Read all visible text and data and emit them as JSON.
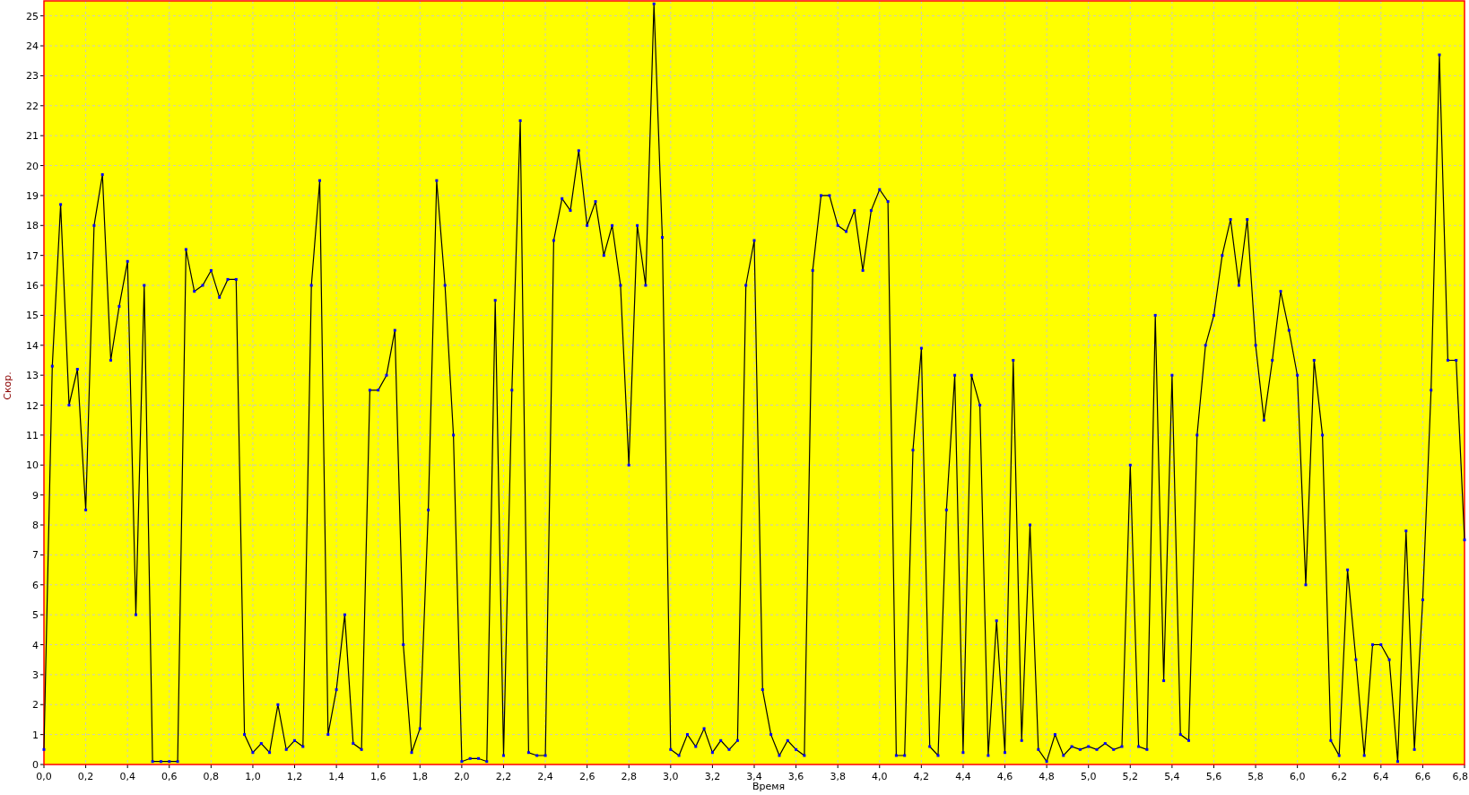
{
  "chart": {
    "chart_data": {
      "type": "line",
      "xlabel": "Время",
      "ylabel": "Скор.",
      "x": [
        0,
        0.04,
        0.08,
        0.12,
        0.16,
        0.2,
        0.24,
        0.28,
        0.32,
        0.36,
        0.4,
        0.44,
        0.48,
        0.52,
        0.56,
        0.6,
        0.64,
        0.68,
        0.72,
        0.76,
        0.8,
        0.84,
        0.88,
        0.92,
        0.96,
        1,
        1.04,
        1.08,
        1.12,
        1.16,
        1.2,
        1.24,
        1.28,
        1.32,
        1.36,
        1.4,
        1.44,
        1.48,
        1.52,
        1.56,
        1.6,
        1.64,
        1.68,
        1.72,
        1.76,
        1.8,
        1.84,
        1.88,
        1.92,
        1.96,
        2,
        2.04,
        2.08,
        2.12,
        2.16,
        2.2,
        2.24,
        2.28,
        2.32,
        2.36,
        2.4,
        2.44,
        2.48,
        2.52,
        2.56,
        2.6,
        2.64,
        2.68,
        2.72,
        2.76,
        2.8,
        2.84,
        2.88,
        2.92,
        2.96,
        3,
        3.04,
        3.08,
        3.12,
        3.16,
        3.2,
        3.24,
        3.28,
        3.32,
        3.36,
        3.4,
        3.44,
        3.48,
        3.52,
        3.56,
        3.6,
        3.64,
        3.68,
        3.72,
        3.76,
        3.8,
        3.84,
        3.88,
        3.92,
        3.96,
        4,
        4.04,
        4.08,
        4.12,
        4.16,
        4.2,
        4.24,
        4.28,
        4.32,
        4.36,
        4.4,
        4.44,
        4.48,
        4.52,
        4.56,
        4.6,
        4.64,
        4.68,
        4.72,
        4.76,
        4.8,
        4.84,
        4.88,
        4.92,
        4.96,
        5,
        5.04,
        5.08,
        5.12,
        5.16,
        5.2,
        5.24,
        5.28,
        5.32,
        5.36,
        5.4,
        5.44,
        5.48,
        5.52,
        5.56,
        5.6,
        5.64,
        5.68,
        5.72,
        5.76,
        5.8,
        5.84,
        5.88,
        5.92,
        5.96,
        6,
        6.04,
        6.08,
        6.12,
        6.16,
        6.2,
        6.24,
        6.28,
        6.32,
        6.36,
        6.4,
        6.44,
        6.48,
        6.52,
        6.56,
        6.6,
        6.64,
        6.68,
        6.72,
        6.76,
        6.8
      ],
      "series": [
        {
          "color": "#000000",
          "values": [
            0.5,
            13.3,
            18.7,
            12.0,
            13.2,
            8.5,
            18.0,
            19.7,
            13.5,
            15.3,
            16.8,
            5.0,
            16.0,
            0.1,
            0.1,
            0.1,
            0.1,
            17.2,
            15.8,
            16.0,
            16.5,
            15.6,
            16.2,
            16.2,
            1.0,
            0.4,
            0.7,
            0.4,
            2.0,
            0.5,
            0.8,
            0.6,
            16.0,
            19.5,
            1.0,
            2.5,
            5.0,
            0.7,
            0.5,
            12.5,
            12.5,
            13.0,
            14.5,
            4.0,
            0.4,
            1.2,
            8.5,
            19.5,
            16.0,
            11.0,
            0.1,
            0.2,
            0.2,
            0.1,
            15.5,
            0.3,
            12.5,
            21.5,
            0.4,
            0.3,
            0.3,
            17.5,
            18.9,
            18.5,
            20.5,
            18.0,
            18.8,
            17.0,
            18.0,
            16.0,
            10.0,
            18.0,
            16.0,
            25.4,
            17.6,
            0.5,
            0.3,
            1.0,
            0.6,
            1.2,
            0.4,
            0.8,
            0.5,
            0.8,
            16.0,
            17.5,
            2.5,
            1.0,
            0.3,
            0.8,
            0.5,
            0.3,
            16.5,
            19.0,
            19.0,
            18.0,
            17.8,
            18.5,
            16.5,
            18.5,
            19.2,
            18.8,
            0.3,
            0.3,
            10.5,
            13.9,
            0.6,
            0.3,
            8.5,
            13.0,
            0.4,
            13.0,
            12.0,
            0.3,
            4.8,
            0.4,
            13.5,
            0.8,
            8.0,
            0.5,
            0.1,
            1.0,
            0.3,
            0.6,
            0.5,
            0.6,
            0.5,
            0.7,
            0.5,
            0.6,
            10.0,
            0.6,
            0.5,
            15.0,
            2.8,
            13.0,
            1.0,
            0.8,
            11.0,
            14.0,
            15.0,
            17.0,
            18.2,
            16.0,
            18.2,
            14.0,
            11.5,
            13.5,
            15.8,
            14.5,
            13.0,
            6.0,
            13.5,
            11.0,
            0.8,
            0.3,
            6.5,
            3.5,
            0.3,
            4.0,
            4.0,
            3.5,
            0.1,
            7.8,
            0.5,
            5.5,
            12.5,
            23.7,
            13.5,
            13.5,
            7.5
          ]
        }
      ],
      "xlim": [
        0,
        6.8
      ],
      "ylim": [
        0,
        25.5
      ],
      "xticks": [
        {
          "value": 0,
          "label": "0,0"
        },
        {
          "value": 0.2,
          "label": "0,2"
        },
        {
          "value": 0.4,
          "label": "0,4"
        },
        {
          "value": 0.6,
          "label": "0,6"
        },
        {
          "value": 0.8,
          "label": "0,8"
        },
        {
          "value": 1,
          "label": "1,0"
        },
        {
          "value": 1.2,
          "label": "1,2"
        },
        {
          "value": 1.4,
          "label": "1,4"
        },
        {
          "value": 1.6,
          "label": "1,6"
        },
        {
          "value": 1.8,
          "label": "1,8"
        },
        {
          "value": 2,
          "label": "2,0"
        },
        {
          "value": 2.2,
          "label": "2,2"
        },
        {
          "value": 2.4,
          "label": "2,4"
        },
        {
          "value": 2.6,
          "label": "2,6"
        },
        {
          "value": 2.8,
          "label": "2,8"
        },
        {
          "value": 3,
          "label": "3,0"
        },
        {
          "value": 3.2,
          "label": "3,2"
        },
        {
          "value": 3.4,
          "label": "3,4"
        },
        {
          "value": 3.6,
          "label": "3,6"
        },
        {
          "value": 3.8,
          "label": "3,8"
        },
        {
          "value": 4,
          "label": "4,0"
        },
        {
          "value": 4.2,
          "label": "4,2"
        },
        {
          "value": 4.4,
          "label": "4,4"
        },
        {
          "value": 4.6,
          "label": "4,6"
        },
        {
          "value": 4.8,
          "label": "4,8"
        },
        {
          "value": 5,
          "label": "5,0"
        },
        {
          "value": 5.2,
          "label": "5,2"
        },
        {
          "value": 5.4,
          "label": "5,4"
        },
        {
          "value": 5.6,
          "label": "5,6"
        },
        {
          "value": 5.8,
          "label": "5,8"
        },
        {
          "value": 6,
          "label": "6,0"
        },
        {
          "value": 6.2,
          "label": "6,2"
        },
        {
          "value": 6.4,
          "label": "6,4"
        },
        {
          "value": 6.6,
          "label": "6,6"
        },
        {
          "value": 6.8,
          "label": "6,8"
        }
      ],
      "grid": true,
      "yticks": [
        0,
        1,
        2,
        3,
        4,
        5,
        6,
        7,
        8,
        9,
        10,
        11,
        12,
        13,
        14,
        15,
        16,
        17,
        18,
        19,
        20,
        21,
        22,
        23,
        24,
        25
      ]
    }
  }
}
